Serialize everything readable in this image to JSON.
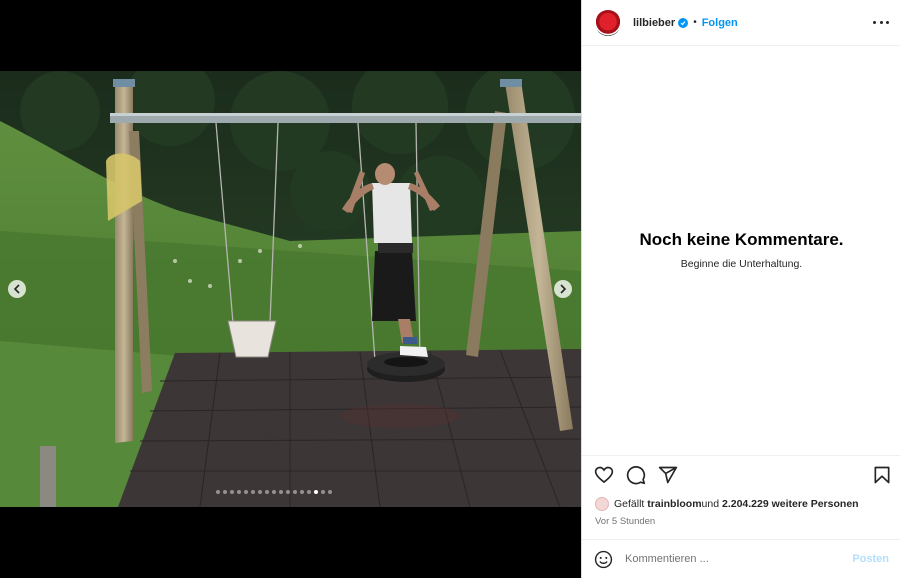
{
  "post": {
    "carousel": {
      "total": 17,
      "active_index": 14
    },
    "photo_alt": "man on a tire swing at a playground"
  },
  "header": {
    "username": "lilbieber",
    "separator": "•",
    "follow_label": "Folgen"
  },
  "comments": {
    "empty_title": "Noch keine Kommentare.",
    "empty_subtitle": "Beginne die Unterhaltung."
  },
  "likes": {
    "prefix": "Gefällt ",
    "user": "trainbloom",
    "middle": " und ",
    "count": "2.204.229 weitere Personen"
  },
  "timestamp": "Vor 5 Stunden",
  "comment_box": {
    "placeholder": "Kommentieren ...",
    "post_label": "Posten"
  },
  "colors": {
    "accent": "#0095f6",
    "post_disabled": "#b2dffc",
    "text": "#262626",
    "muted": "#737373"
  },
  "icons": [
    "heart-icon",
    "comment-icon",
    "share-icon",
    "bookmark-icon",
    "emoji-icon",
    "more-icon",
    "verified-icon",
    "chevron-left-icon",
    "chevron-right-icon"
  ]
}
